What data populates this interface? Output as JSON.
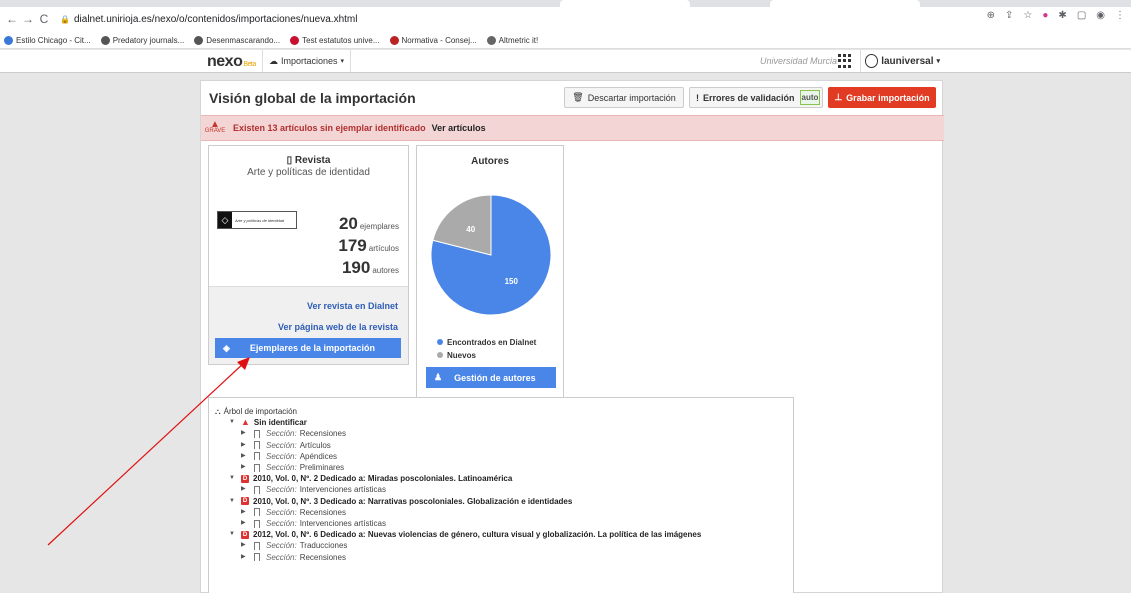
{
  "browser": {
    "url": "dialnet.unirioja.es/nexo/o/contenidos/importaciones/nueva.xhtml",
    "bookmarks": [
      "Estilo Chicago - Cit...",
      "Predatory journals...",
      "Desenmascarando...",
      "Test estatutos unive...",
      "Normativa - Consej...",
      "Altmetric it!"
    ]
  },
  "nav": {
    "logo": "nexo",
    "beta": "Beta",
    "menu": "Importaciones",
    "university": "Universidad Murcia",
    "user": "launiversal"
  },
  "header": {
    "title": "Visión global de la importación",
    "discard": "Descartar importación",
    "errors": "Errores de validación",
    "auto": "auto",
    "save": "Grabar importación"
  },
  "alert": {
    "level": "GRAVE",
    "message": "Existen 13 artículos sin ejemplar identificado",
    "link": "Ver artículos"
  },
  "revista": {
    "label": "Revista",
    "name": "Arte y políticas de identidad",
    "logo_text": "Arte y políticas de identidad",
    "ejemplares_n": "20",
    "ejemplares": "ejemplares",
    "articulos_n": "179",
    "articulos": "artículos",
    "autores_n": "190",
    "autores": "autores",
    "link_dialnet": "Ver revista en Dialnet",
    "link_web": "Ver página web de la revista",
    "btn_ejemplares": "Ejemplares de la importación"
  },
  "autores": {
    "title": "Autores",
    "legend_found": "Encontrados en Dialnet",
    "legend_new": "Nuevos",
    "btn": "Gestión de autores",
    "colors": {
      "found": "#4a86e8",
      "new": "#aaaaaa"
    }
  },
  "chart_data": {
    "type": "pie",
    "labels": [
      "Encontrados en Dialnet",
      "Nuevos"
    ],
    "values": [
      150,
      40
    ],
    "colors": [
      "#4a86e8",
      "#aaaaaa"
    ]
  },
  "tree": {
    "title": "Árbol de importación",
    "section_label": "Sección:",
    "sin_identificar": "Sin identificar",
    "g1": [
      "Recensiones",
      "Artículos",
      "Apéndices",
      "Preliminares"
    ],
    "issue1": "2010, Vol. 0, Nº. 2 Dedicado a: Miradas poscoloniales. Latinoamérica",
    "g2": [
      "Intervenciones artísticas"
    ],
    "issue2": "2010, Vol. 0, Nº. 3 Dedicado a: Narrativas poscoloniales. Globalización e identidades",
    "g3": [
      "Recensiones",
      "Intervenciones artísticas"
    ],
    "issue3": "2012, Vol. 0, Nº. 6 Dedicado a: Nuevas violencias de género, cultura visual y globalización. La política de las imágenes",
    "g4": [
      "Traducciones",
      "Recensiones"
    ]
  }
}
